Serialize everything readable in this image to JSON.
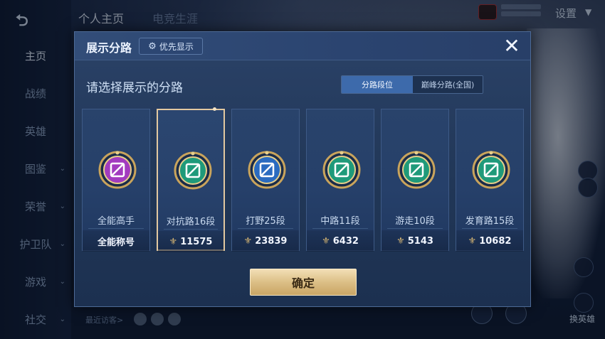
{
  "nav": {
    "back": "⮌",
    "items": [
      {
        "label": "主页",
        "chevron": ""
      },
      {
        "label": "战绩",
        "chevron": ""
      },
      {
        "label": "英雄",
        "chevron": ""
      },
      {
        "label": "图鉴",
        "chevron": "⌄"
      },
      {
        "label": "荣誉",
        "chevron": "⌄"
      },
      {
        "label": "护卫队",
        "chevron": "⌄"
      },
      {
        "label": "游戏",
        "chevron": "⌄"
      },
      {
        "label": "社交",
        "chevron": "⌄"
      }
    ]
  },
  "top_tabs": [
    "个人主页",
    "电竞生涯"
  ],
  "settings_label": "设置",
  "swap_hero_label": "换英雄",
  "visitors_label": "最近访客>",
  "modal": {
    "title": "展示分路",
    "priority_label": "优先显示",
    "close": "✕",
    "subtitle": "请选择展示的分路",
    "segments": [
      "分路段位",
      "巅峰分路(全国)"
    ],
    "confirm_label": "确定",
    "lanes": [
      {
        "name": "全能高手",
        "value": "全能称号",
        "color": "#a23bbf",
        "icon": "all-round-emblem-icon"
      },
      {
        "name": "对抗路16段",
        "value": "11575",
        "color": "#1f9a7a",
        "icon": "clash-lane-emblem-icon"
      },
      {
        "name": "打野25段",
        "value": "23839",
        "color": "#2a6bc0",
        "icon": "jungle-emblem-icon"
      },
      {
        "name": "中路11段",
        "value": "6432",
        "color": "#1f9a7a",
        "icon": "mid-lane-emblem-icon"
      },
      {
        "name": "游走10段",
        "value": "5143",
        "color": "#1f9a7a",
        "icon": "roam-emblem-icon"
      },
      {
        "name": "发育路15段",
        "value": "10682",
        "color": "#1f9a7a",
        "icon": "farm-lane-emblem-icon"
      }
    ],
    "selected_index": 1
  }
}
